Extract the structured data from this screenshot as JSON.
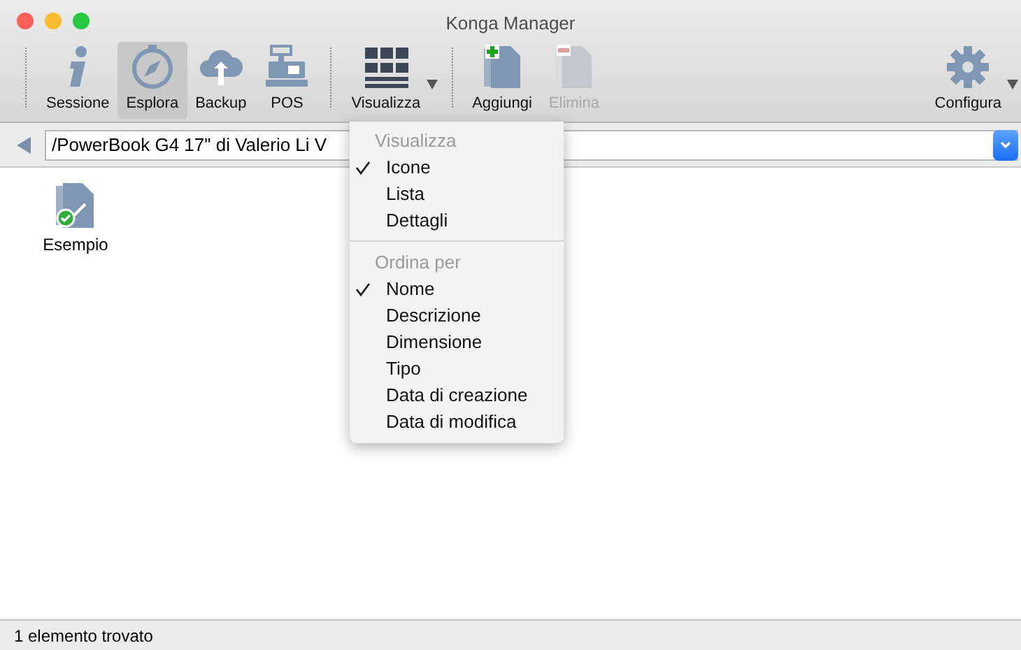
{
  "window": {
    "title": "Konga Manager"
  },
  "toolbar": {
    "groups": [
      [
        {
          "label": "Sessione",
          "selected": false,
          "disabled": false,
          "dropdown": false
        },
        {
          "label": "Esplora",
          "selected": true,
          "disabled": false,
          "dropdown": false
        },
        {
          "label": "Backup",
          "selected": false,
          "disabled": false,
          "dropdown": false
        },
        {
          "label": "POS",
          "selected": false,
          "disabled": false,
          "dropdown": false
        }
      ],
      [
        {
          "label": "Visualizza",
          "selected": false,
          "disabled": false,
          "dropdown": true
        }
      ],
      [
        {
          "label": "Aggiungi",
          "selected": false,
          "disabled": false,
          "dropdown": false
        },
        {
          "label": "Elimina",
          "selected": false,
          "disabled": true,
          "dropdown": false
        }
      ]
    ],
    "right": {
      "label": "Configura",
      "selected": false,
      "disabled": false,
      "dropdown": true
    }
  },
  "path_bar": {
    "value": "/PowerBook G4 17\" di Valerio Li V"
  },
  "files": [
    {
      "name": "Esempio"
    }
  ],
  "menu": {
    "sections": [
      {
        "header": "Visualizza",
        "items": [
          {
            "label": "Icone",
            "checked": true
          },
          {
            "label": "Lista",
            "checked": false
          },
          {
            "label": "Dettagli",
            "checked": false
          }
        ]
      },
      {
        "header": "Ordina per",
        "items": [
          {
            "label": "Nome",
            "checked": true
          },
          {
            "label": "Descrizione",
            "checked": false
          },
          {
            "label": "Dimensione",
            "checked": false
          },
          {
            "label": "Tipo",
            "checked": false
          },
          {
            "label": "Data di creazione",
            "checked": false
          },
          {
            "label": "Data di modifica",
            "checked": false
          }
        ]
      }
    ]
  },
  "status_bar": {
    "text": "1 elemento trovato"
  }
}
